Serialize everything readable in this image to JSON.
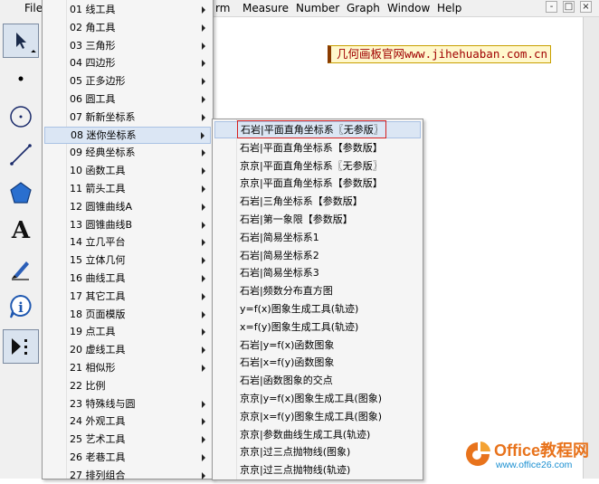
{
  "menubar": {
    "items": [
      "File",
      "rm",
      "Measure",
      "Number",
      "Graph",
      "Window",
      "Help"
    ]
  },
  "window_buttons": [
    "-",
    "□",
    "×"
  ],
  "toolbar": {
    "tools": [
      {
        "name": "arrow-select-tool",
        "icon": "arrow-select-icon",
        "active": true
      },
      {
        "name": "point-tool",
        "icon": "point-icon"
      },
      {
        "name": "compass-tool",
        "icon": "circle-icon"
      },
      {
        "name": "straightedge-tool",
        "icon": "line-segment-icon"
      },
      {
        "name": "polygon-tool",
        "icon": "polygon-icon"
      },
      {
        "name": "text-tool",
        "icon": "text-a-icon",
        "glyph": "A"
      },
      {
        "name": "marker-tool",
        "icon": "marker-pen-icon"
      },
      {
        "name": "information-tool",
        "icon": "info-icon",
        "glyph": "i"
      },
      {
        "name": "custom-tools",
        "icon": "custom-tools-icon",
        "active": true
      }
    ]
  },
  "canvas": {
    "watermark_title": "几何画板官网www.jihehuaban.com.cn"
  },
  "custom_tools_menu": {
    "highlighted_index": 7,
    "items": [
      "01 线工具",
      "02 角工具",
      "03 三角形",
      "04 四边形",
      "05 正多边形",
      "06 圆工具",
      "07 新新坐标系",
      "08 迷你坐标系",
      "09 经典坐标系",
      "10 函数工具",
      "11 箭头工具",
      "12 圆锥曲线A",
      "13 圆锥曲线B",
      "14 立几平台",
      "15 立体几何",
      "16 曲线工具",
      "17 其它工具",
      "18 页面模版",
      "19 点工具",
      "20 虚线工具",
      "21 相似形",
      "22 比例",
      "23 特殊线与圆",
      "24 外观工具",
      "25 艺术工具",
      "26 老巷工具",
      "27 排列组合"
    ],
    "no_submenu_indices": [
      21
    ]
  },
  "mini_coordinate_submenu": {
    "highlighted_index": 0,
    "items": [
      "石岩|平面直角坐标系〖无参版〗",
      "石岩|平面直角坐标系【参数版】",
      "京京|平面直角坐标系〖无参版〗",
      "京京|平面直角坐标系【参数版】",
      "石岩|三角坐标系【参数版】",
      "石岩|第一象限【参数版】",
      "石岩|简易坐标系1",
      "石岩|简易坐标系2",
      "石岩|简易坐标系3",
      "石岩|频数分布直方图",
      "y=f(x)图象生成工具(轨迹)",
      "x=f(y)图象生成工具(轨迹)",
      "石岩|y=f(x)函数图象",
      "石岩|x=f(y)函数图象",
      "石岩|函数图象的交点",
      "京京|y=f(x)图象生成工具(图象)",
      "京京|x=f(y)图象生成工具(图象)",
      "京京|参数曲线生成工具(轨迹)",
      "京京|过三点抛物线(图象)",
      "京京|过三点抛物线(轨迹)"
    ]
  },
  "office_watermark": {
    "brand": "Office教程网",
    "url": "www.office26.com"
  },
  "colors": {
    "highlight_bg": "#dbe6f4",
    "highlight_border": "#aac2e4",
    "red_annotation": "#d62020",
    "watermark_text": "#a00000"
  }
}
